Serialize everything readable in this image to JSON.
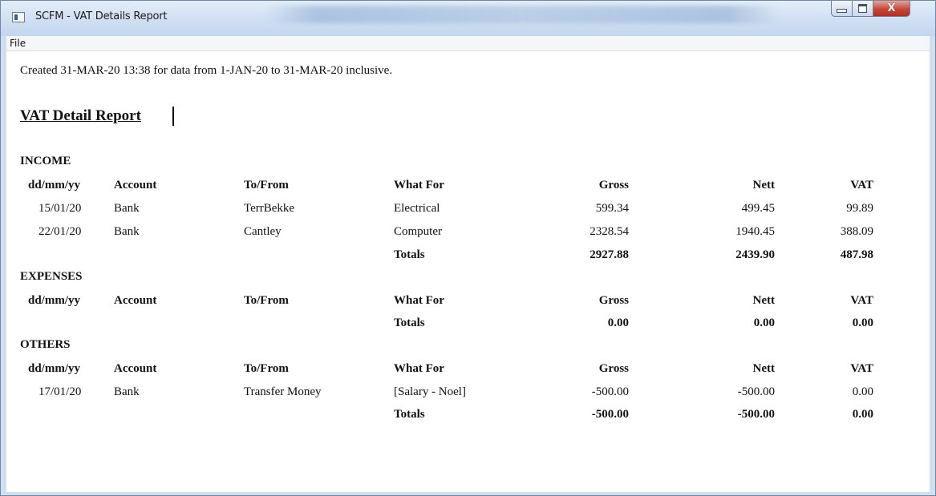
{
  "window": {
    "title": "SCFM - VAT Details Report",
    "buttons": {
      "minimize": "minimize",
      "maximize": "maximize",
      "close": "X"
    }
  },
  "menu": {
    "file": "File"
  },
  "report": {
    "created_line": "Created 31-MAR-20 13:38 for data from  1-JAN-20 to 31-MAR-20 inclusive.",
    "title": "VAT Detail Report",
    "columns": {
      "date": "dd/mm/yy",
      "account": "Account",
      "to_from": "To/From",
      "what_for": "What For",
      "gross": "Gross",
      "nett": "Nett",
      "vat": "VAT"
    },
    "totals_label": "Totals",
    "income": {
      "label": "INCOME",
      "rows": [
        {
          "date": "15/01/20",
          "account": "Bank",
          "to_from": "TerrBekke",
          "what_for": "Electrical",
          "gross": "599.34",
          "nett": "499.45",
          "vat": "99.89"
        },
        {
          "date": "22/01/20",
          "account": "Bank",
          "to_from": "Cantley",
          "what_for": "Computer",
          "gross": "2328.54",
          "nett": "1940.45",
          "vat": "388.09"
        }
      ],
      "totals": {
        "gross": "2927.88",
        "nett": "2439.90",
        "vat": "487.98"
      }
    },
    "expenses": {
      "label": "EXPENSES",
      "rows": [],
      "totals": {
        "gross": "0.00",
        "nett": "0.00",
        "vat": "0.00"
      }
    },
    "others": {
      "label": "OTHERS",
      "rows": [
        {
          "date": "17/01/20",
          "account": "Bank",
          "to_from": "Transfer Money",
          "what_for": "[Salary - Noel]",
          "gross": "-500.00",
          "nett": "-500.00",
          "vat": "0.00"
        }
      ],
      "totals": {
        "gross": "-500.00",
        "nett": "-500.00",
        "vat": "0.00"
      }
    }
  }
}
